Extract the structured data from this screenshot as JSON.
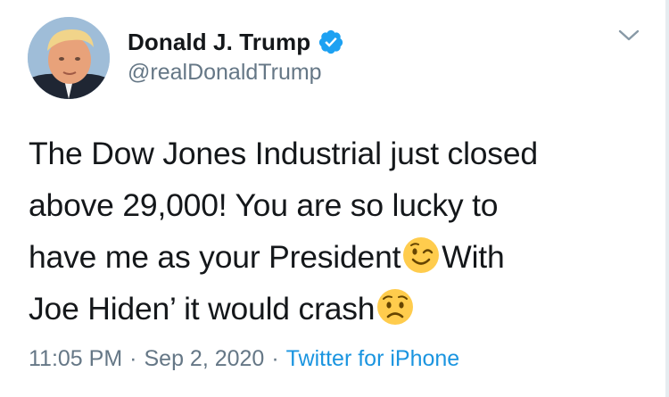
{
  "author": {
    "display_name": "Donald J. Trump",
    "handle": "@realDonaldTrump",
    "verified": true
  },
  "tweet": {
    "lines": [
      {
        "text": "The Dow Jones Industrial just closed"
      },
      {
        "text": "above 29,000! You are so lucky to"
      },
      {
        "text": "have me as your President",
        "emoji_after": "winking-face-emoji",
        "text_after": "With"
      },
      {
        "text": "Joe Hiden’ it would crash",
        "emoji_after": "worried-face-emoji"
      }
    ]
  },
  "meta": {
    "time": "11:05 PM",
    "separator": "·",
    "date": "Sep 2, 2020",
    "source": "Twitter for iPhone"
  },
  "icons": {
    "verified": "verified-badge-icon",
    "menu": "chevron-down-icon"
  },
  "colors": {
    "text": "#14171a",
    "secondary": "#657786",
    "link": "#1b95e0",
    "verified": "#1da1f2",
    "emoji": "#ffcc4d"
  }
}
